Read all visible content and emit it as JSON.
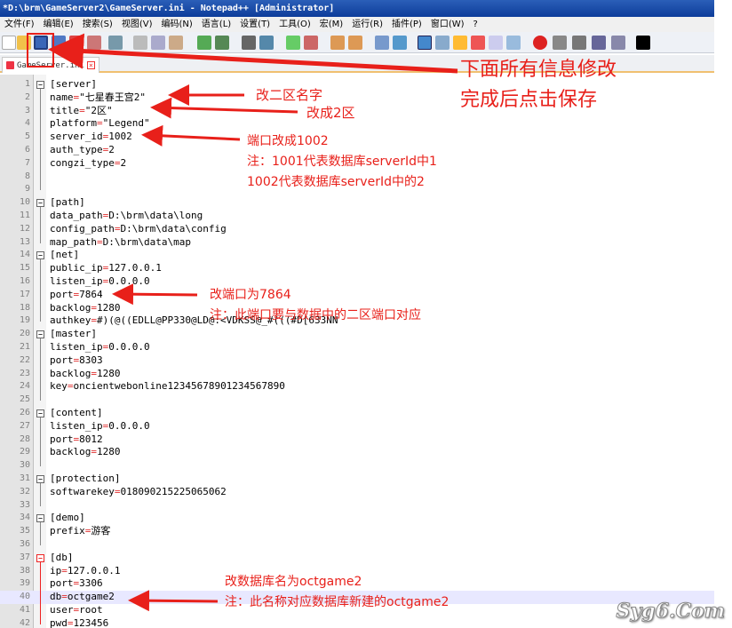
{
  "window": {
    "title": "*D:\\brm\\GameServer2\\GameServer.ini - Notepad++ [Administrator]"
  },
  "menu": [
    "文件(F)",
    "编辑(E)",
    "搜索(S)",
    "视图(V)",
    "编码(N)",
    "语言(L)",
    "设置(T)",
    "工具(O)",
    "宏(M)",
    "运行(R)",
    "插件(P)",
    "窗口(W)",
    "?"
  ],
  "tab": {
    "label": "GameServer.ini"
  },
  "lines": [
    {
      "n": "1",
      "text": "[server]"
    },
    {
      "n": "2",
      "text": "name=\"七星春王宫2\""
    },
    {
      "n": "3",
      "text": "title=\"2区\""
    },
    {
      "n": "4",
      "text": "platform=\"Legend\""
    },
    {
      "n": "5",
      "text": "server_id=1002"
    },
    {
      "n": "6",
      "text": "auth_type=2"
    },
    {
      "n": "7",
      "text": "congzi_type=2"
    },
    {
      "n": "8",
      "text": ""
    },
    {
      "n": "9",
      "text": ""
    },
    {
      "n": "10",
      "text": "[path]"
    },
    {
      "n": "11",
      "text": "data_path=D:\\brm\\data\\long"
    },
    {
      "n": "12",
      "text": "config_path=D:\\brm\\data\\config"
    },
    {
      "n": "13",
      "text": "map_path=D:\\brm\\data\\map"
    },
    {
      "n": "14",
      "text": "[net]"
    },
    {
      "n": "15",
      "text": "public_ip=127.0.0.1"
    },
    {
      "n": "16",
      "text": "listen_ip=0.0.0.0"
    },
    {
      "n": "17",
      "text": "port=7864"
    },
    {
      "n": "18",
      "text": "backlog=1280"
    },
    {
      "n": "19",
      "text": "authkey=#)(@((EDLL@PP330@LD@:<VDKSS@_#(((#D[633NN"
    },
    {
      "n": "20",
      "text": "[master]"
    },
    {
      "n": "21",
      "text": "listen_ip=0.0.0.0"
    },
    {
      "n": "22",
      "text": "port=8303"
    },
    {
      "n": "23",
      "text": "backlog=1280"
    },
    {
      "n": "24",
      "text": "key=oncientwebonline12345678901234567890"
    },
    {
      "n": "25",
      "text": ""
    },
    {
      "n": "26",
      "text": "[content]"
    },
    {
      "n": "27",
      "text": "listen_ip=0.0.0.0"
    },
    {
      "n": "28",
      "text": "port=8012"
    },
    {
      "n": "29",
      "text": "backlog=1280"
    },
    {
      "n": "30",
      "text": ""
    },
    {
      "n": "31",
      "text": "[protection]"
    },
    {
      "n": "32",
      "text": "softwarekey=018090215225065062"
    },
    {
      "n": "33",
      "text": ""
    },
    {
      "n": "34",
      "text": "[demo]"
    },
    {
      "n": "35",
      "text": "prefix=游客"
    },
    {
      "n": "36",
      "text": ""
    },
    {
      "n": "37",
      "text": "[db]"
    },
    {
      "n": "38",
      "text": "ip=127.0.0.1"
    },
    {
      "n": "39",
      "text": "port=3306"
    },
    {
      "n": "40",
      "text": "db=octgame2"
    },
    {
      "n": "41",
      "text": "user=root"
    },
    {
      "n": "42",
      "text": "pwd=123456"
    }
  ],
  "annotations": {
    "save_l1": "下面所有信息修改",
    "save_l2": "完成后点击保存",
    "name": "改二区名字",
    "title": "改成2区",
    "server_id": "端口改成1002",
    "server_note1": "注：1001代表数据库serverId中1",
    "server_note2": "1002代表数据库serverId中的2",
    "port": "改端口为7864",
    "port_note": "注：此端口要与数据中的二区端口对应",
    "db": "改数据库名为octgame2",
    "db_note": "注：此名称对应数据库新建的octgame2"
  },
  "watermark": "Syg6.Com",
  "colors": {
    "annotation": "#e8201a",
    "section": "#1a1aff",
    "operator": "#e03030"
  }
}
